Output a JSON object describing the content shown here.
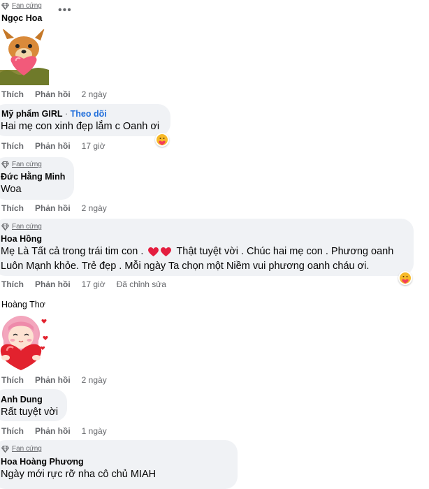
{
  "badge_label": "Fan cứng",
  "more_icon": "•••",
  "actions": {
    "like": "Thích",
    "reply": "Phản hồi"
  },
  "colors": {
    "bubble": "#f0f2f5",
    "meta": "#65676b",
    "link": "#216fdb",
    "heart": "#e41e3f"
  },
  "comments": [
    {
      "name": "Ngọc Hoa",
      "time": "2 ngày",
      "sticker": "dog-with-heart-sticker"
    },
    {
      "name": "Mỹ phẩm GIRL",
      "follow": "Theo dõi",
      "text": "Hai mẹ con xinh đẹp lắm c Oanh ơi",
      "time": "17 giờ",
      "reaction": "care-reaction"
    },
    {
      "name": "Đức Hằng Minh",
      "text": "Woa",
      "time": "2 ngày"
    },
    {
      "name": "Hoa Hồng",
      "text1a": "Mẹ Là Tất cả trong trái tim con .",
      "text1b": "Thật tuyệt vời . Chúc hai mẹ con . Phương oanh",
      "text2": "Luôn Mạnh khỏe. Trẻ đẹp . Mỗi ngày Ta chọn một Niềm vui phương oanh cháu ơi.",
      "time": "17 giờ",
      "edited": "Đã chỉnh sửa",
      "reaction": "care-reaction"
    },
    {
      "name": "Hoàng Thơ",
      "time": "2 ngày",
      "sticker": "girl-hugging-heart-sticker"
    },
    {
      "name": "Anh Dung",
      "text": "Rất tuyệt vời",
      "time": "1 ngày"
    },
    {
      "name": "Hoa Hoàng Phương",
      "text": "Ngày mới rực rỡ nha cô chủ MIAH"
    }
  ]
}
